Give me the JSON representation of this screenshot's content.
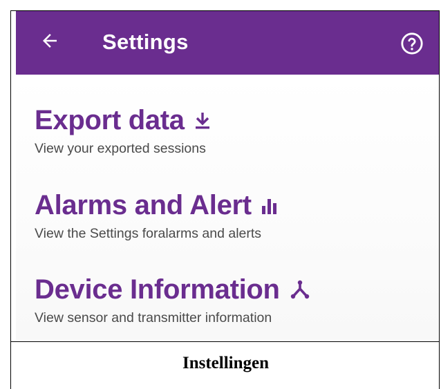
{
  "colors": {
    "brand": "#6a2d8f",
    "accent": "#6a2d8f"
  },
  "appbar": {
    "title": "Settings",
    "back_icon": "arrow-left-icon",
    "help_icon": "help-circle-icon"
  },
  "items": [
    {
      "title": "Export data",
      "subtitle": "View your exported sessions",
      "icon": "download-icon"
    },
    {
      "title": "Alarms and Alert",
      "subtitle": "View the Settings foralarms and alerts",
      "icon": "bar-chart-icon"
    },
    {
      "title": "Device Information",
      "subtitle": "View sensor and transmitter information",
      "icon": "device-hub-icon"
    }
  ],
  "caption": "Instellingen"
}
